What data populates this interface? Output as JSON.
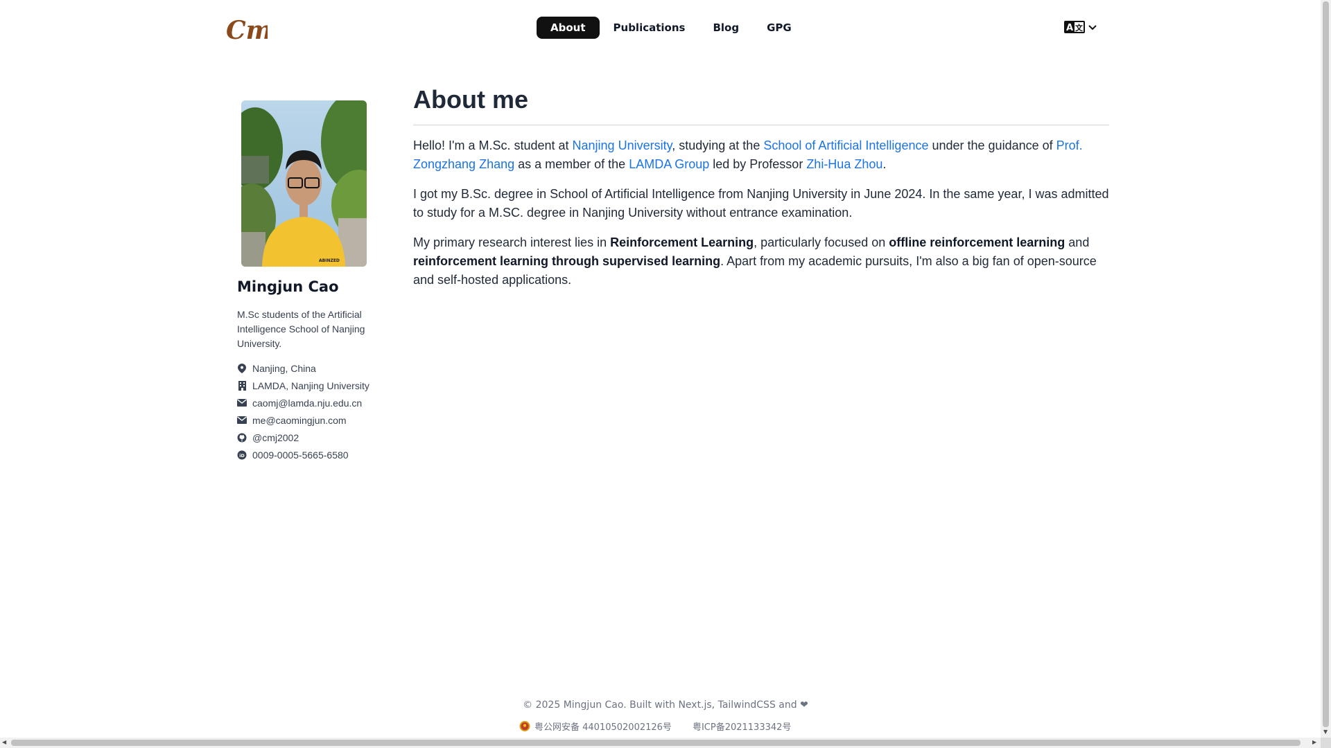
{
  "header": {
    "logo_text": "Cmj",
    "nav": [
      {
        "label": "About",
        "active": true
      },
      {
        "label": "Publications",
        "active": false
      },
      {
        "label": "Blog",
        "active": false
      },
      {
        "label": "GPG",
        "active": false
      }
    ],
    "language_icon": "translate-icon"
  },
  "profile": {
    "name": "Mingjun Cao",
    "bio": "M.Sc students of the Artificial Intelligence School of Nanjing University.",
    "contacts": [
      {
        "icon": "location-icon",
        "text": "Nanjing, China"
      },
      {
        "icon": "building-icon",
        "text": "LAMDA, Nanjing University"
      },
      {
        "icon": "mail-icon",
        "text": "caomj@lamda.nju.edu.cn"
      },
      {
        "icon": "mail-icon",
        "text": "me@caomingjun.com"
      },
      {
        "icon": "github-icon",
        "text": "@cmj2002"
      },
      {
        "icon": "orcid-icon",
        "text": "0009-0005-5665-6580"
      }
    ]
  },
  "main": {
    "title": "About me",
    "p1": {
      "t1": "Hello! I'm a M.Sc. student at ",
      "l1": "Nanjing University",
      "t2": ", studying at the ",
      "l2": "School of Artificial Intelligence",
      "t3": " under the guidance of ",
      "l3": "Prof. Zongzhang Zhang",
      "t4": " as a member of the ",
      "l4": "LAMDA Group",
      "t5": " led by Professor ",
      "l5": "Zhi-Hua Zhou",
      "t6": "."
    },
    "p2": "I got my B.Sc. degree in School of Artificial Intelligence from Nanjing University in June 2024. In the same year, I was admitted to study for a M.SC. degree in Nanjing University without entrance examination.",
    "p3": {
      "t1": "My primary research interest lies in ",
      "b1": "Reinforcement Learning",
      "t2": ", particularly focused on ",
      "b2": "offline reinforcement learning",
      "t3": " and ",
      "b3": "reinforcement learning through supervised learning",
      "t4": ". Apart from my academic pursuits, I'm also a big fan of open-source and self-hosted applications."
    }
  },
  "footer": {
    "copyright": "© 2025 Mingjun Cao. Built with Next.js, TailwindCSS and ❤",
    "police_beian": "粤公网安备 44010502002126号",
    "icp": "粤ICP备2021133342号"
  },
  "colors": {
    "link": "#1a73e8",
    "logo": "#8b4a1c",
    "nav_active_bg": "#111111"
  }
}
